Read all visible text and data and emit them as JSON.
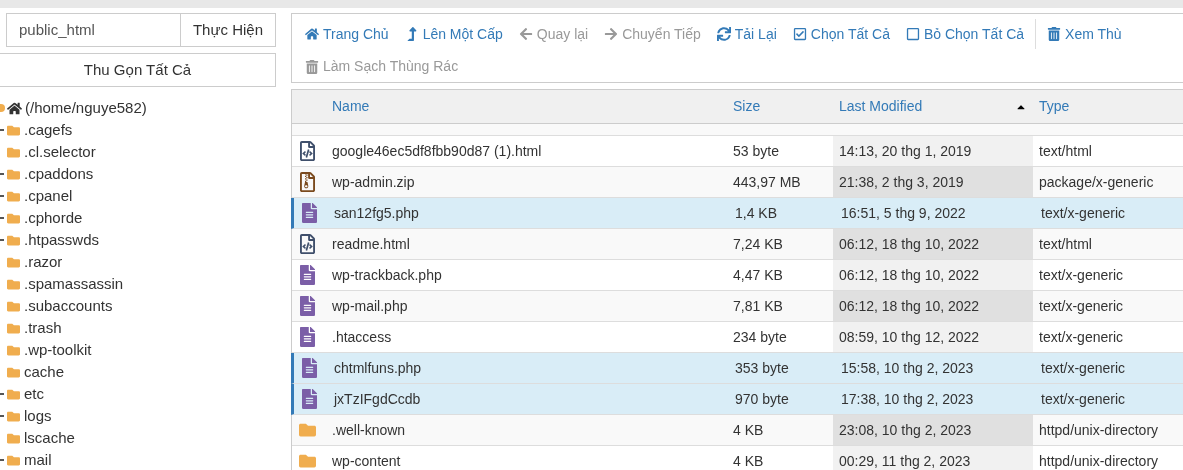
{
  "path_bar": {
    "value": "public_html",
    "button": "Thực Hiện"
  },
  "collapse_button": "Thu Gọn Tất Cả",
  "tree": {
    "label": "(/home/nguye582)",
    "children": [
      {
        "label": ".cagefs",
        "expandable": true
      },
      {
        "label": ".cl.selector",
        "expandable": false
      },
      {
        "label": ".cpaddons",
        "expandable": true
      },
      {
        "label": ".cpanel",
        "expandable": true
      },
      {
        "label": ".cphorde",
        "expandable": true
      },
      {
        "label": ".htpasswds",
        "expandable": true
      },
      {
        "label": ".razor",
        "expandable": false
      },
      {
        "label": ".spamassassin",
        "expandable": false
      },
      {
        "label": ".subaccounts",
        "expandable": false
      },
      {
        "label": ".trash",
        "expandable": false
      },
      {
        "label": ".wp-toolkit",
        "expandable": false
      },
      {
        "label": "cache",
        "expandable": false
      },
      {
        "label": "etc",
        "expandable": true
      },
      {
        "label": "logs",
        "expandable": true
      },
      {
        "label": "lscache",
        "expandable": false
      },
      {
        "label": "mail",
        "expandable": true
      }
    ]
  },
  "toolbar": [
    {
      "kind": "home",
      "label": "Trang Chủ",
      "disabled": false
    },
    {
      "kind": "up",
      "label": "Lên Một Cấp",
      "disabled": false
    },
    {
      "kind": "back",
      "label": "Quay lại",
      "disabled": true
    },
    {
      "kind": "forward",
      "label": "Chuyển Tiếp",
      "disabled": true
    },
    {
      "kind": "reload",
      "label": "Tải Lại",
      "disabled": false
    },
    {
      "kind": "select",
      "label": "Chọn Tất Cả",
      "disabled": false
    },
    {
      "kind": "deselect",
      "label": "Bỏ Chọn Tất Cả",
      "disabled": false
    },
    {
      "kind": "trash",
      "label": "Xem Thù",
      "disabled": false
    },
    {
      "kind": "trash",
      "label": "Làm Sạch Thùng Rác",
      "disabled": true
    }
  ],
  "table": {
    "columns": [
      {
        "label": "Name",
        "sorted": false
      },
      {
        "label": "Size",
        "sorted": false
      },
      {
        "label": "Last Modified",
        "sorted": true
      },
      {
        "label": "Type",
        "sorted": false
      }
    ],
    "rows": [
      {
        "kind": "html",
        "name": "google46ec5df8fbb90d87 (1).html",
        "size": "53 byte",
        "modified": "14:13, 20 thg 1, 2019",
        "type": "text/html",
        "selected": false
      },
      {
        "kind": "zip",
        "name": "wp-admin.zip",
        "size": "443,97 MB",
        "modified": "21:38, 2 thg 3, 2019",
        "type": "package/x-generic",
        "selected": false
      },
      {
        "kind": "text",
        "name": "san12fg5.php",
        "size": "1,4 KB",
        "modified": "16:51, 5 thg 9, 2022",
        "type": "text/x-generic",
        "selected": true
      },
      {
        "kind": "html",
        "name": "readme.html",
        "size": "7,24 KB",
        "modified": "06:12, 18 thg 10, 2022",
        "type": "text/html",
        "selected": false
      },
      {
        "kind": "text",
        "name": "wp-trackback.php",
        "size": "4,47 KB",
        "modified": "06:12, 18 thg 10, 2022",
        "type": "text/x-generic",
        "selected": false
      },
      {
        "kind": "text",
        "name": "wp-mail.php",
        "size": "7,81 KB",
        "modified": "06:12, 18 thg 10, 2022",
        "type": "text/x-generic",
        "selected": false
      },
      {
        "kind": "text",
        "name": ".htaccess",
        "size": "234 byte",
        "modified": "08:59, 10 thg 12, 2022",
        "type": "text/x-generic",
        "selected": false
      },
      {
        "kind": "text",
        "name": "chtmlfuns.php",
        "size": "353 byte",
        "modified": "15:58, 10 thg 2, 2023",
        "type": "text/x-generic",
        "selected": true
      },
      {
        "kind": "text",
        "name": "jxTzIFgdCcdb",
        "size": "970 byte",
        "modified": "17:38, 10 thg 2, 2023",
        "type": "text/x-generic",
        "selected": true
      },
      {
        "kind": "folder",
        "name": ".well-known",
        "size": "4 KB",
        "modified": "23:08, 10 thg 2, 2023",
        "type": "httpd/unix-directory",
        "selected": false
      },
      {
        "kind": "folder",
        "name": "wp-content",
        "size": "4 KB",
        "modified": "00:29, 11 thg 2, 2023",
        "type": "httpd/unix-directory",
        "selected": false
      }
    ]
  }
}
